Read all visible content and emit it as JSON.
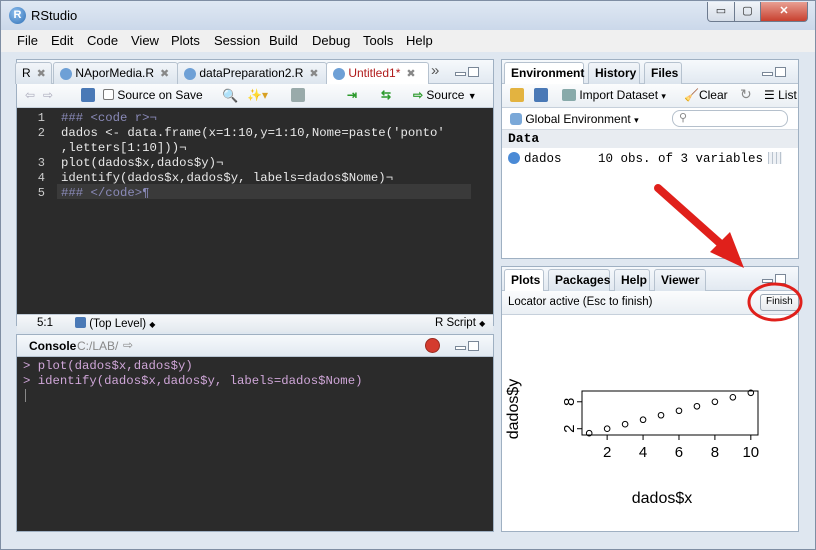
{
  "window": {
    "title": "RStudio",
    "min": "▭",
    "max": "▢",
    "close": "✕"
  },
  "menu": [
    "File",
    "Edit",
    "Code",
    "View",
    "Plots",
    "Session",
    "Build",
    "Debug",
    "Tools",
    "Help"
  ],
  "editor": {
    "tabs": [
      {
        "label": "R",
        "close": "✖"
      },
      {
        "label": "NAporMedia.R",
        "close": "✖"
      },
      {
        "label": "dataPreparation2.R",
        "close": "✖"
      },
      {
        "label": "Untitled1*",
        "close": "✖"
      }
    ],
    "more_tabs": "»",
    "toolbar": {
      "source_on_save": "Source on Save",
      "source": "Source"
    },
    "lines": [
      {
        "n": "1",
        "text": "### <code r>¬"
      },
      {
        "n": "2",
        "text": "dados <- data.frame(x=1:10,y=1:10,Nome=paste('ponto'"
      },
      {
        "n": "",
        "text": ",letters[1:10]))¬"
      },
      {
        "n": "3",
        "text": "plot(dados$x,dados$y)¬"
      },
      {
        "n": "4",
        "text": "identify(dados$x,dados$y, labels=dados$Nome)¬"
      },
      {
        "n": "5",
        "text": "### </code>¶"
      }
    ],
    "status": {
      "position": "5:1",
      "scope": "(Top Level)",
      "filetype": "R Script"
    }
  },
  "console": {
    "title": "Console",
    "path": "C:/LAB/",
    "lines": [
      "> plot(dados$x,dados$y)",
      "> identify(dados$x,dados$y, labels=dados$Nome)"
    ]
  },
  "env": {
    "tabs": [
      "Environment",
      "History",
      "Files"
    ],
    "toolbar": {
      "import": "Import Dataset",
      "clear": "Clear",
      "list": "List"
    },
    "scope": "Global Environment",
    "section": "Data",
    "rows": [
      {
        "name": "dados",
        "value": "10 obs. of 3 variables"
      }
    ]
  },
  "plots": {
    "tabs": [
      "Plots",
      "Packages",
      "Help",
      "Viewer"
    ],
    "locator": "Locator active (Esc to finish)",
    "finish": "Finish"
  },
  "chart_data": {
    "type": "scatter",
    "x": [
      1,
      2,
      3,
      4,
      5,
      6,
      7,
      8,
      9,
      10
    ],
    "y": [
      1,
      2,
      3,
      4,
      5,
      6,
      7,
      8,
      9,
      10
    ],
    "xlabel": "dados$x",
    "ylabel": "dados$y",
    "xticks": [
      "2",
      "4",
      "6",
      "8",
      "10"
    ],
    "yticks": [
      "2",
      "8"
    ],
    "xlim": [
      1,
      10
    ],
    "ylim": [
      1,
      10
    ]
  },
  "colors": {
    "annotation": "#e0201b",
    "code_bg": "#2b2b2b",
    "comment": "#8a8ab8"
  }
}
